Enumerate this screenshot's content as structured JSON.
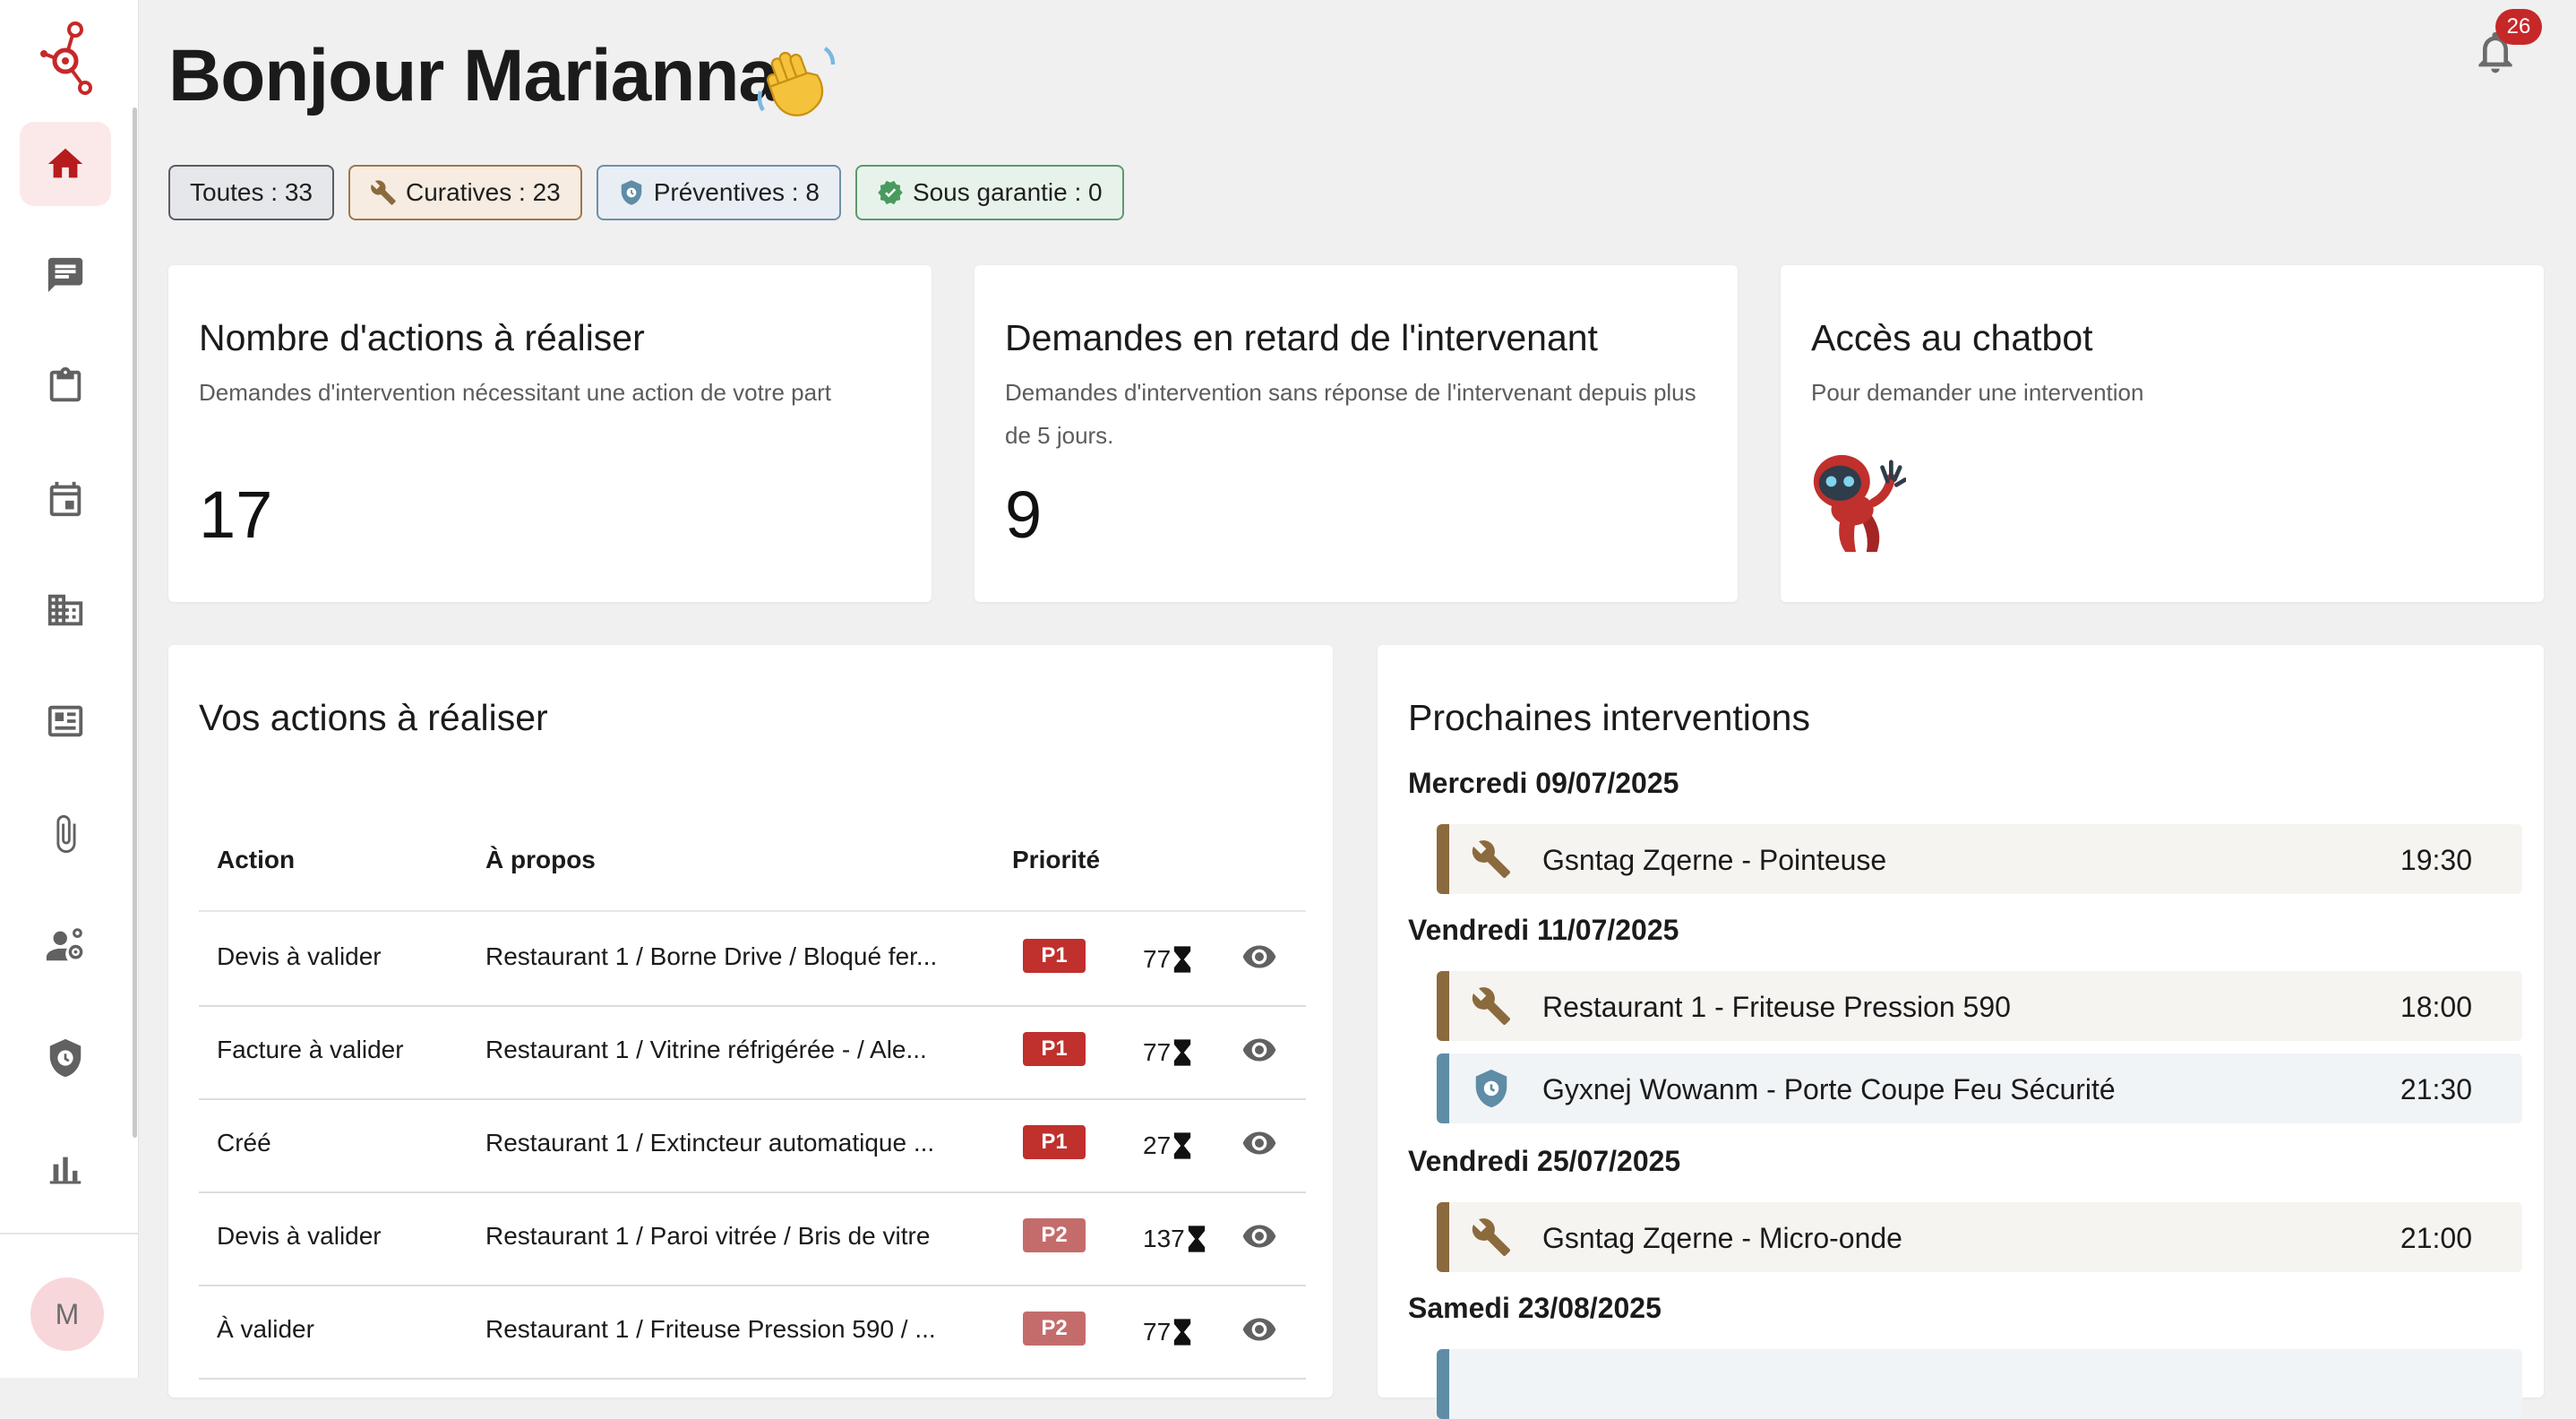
{
  "header": {
    "greeting": "Bonjour Marianna",
    "notifications_count": "26"
  },
  "sidebar": {
    "items": [
      {
        "icon": "home-icon",
        "active": true
      },
      {
        "icon": "chat-icon"
      },
      {
        "icon": "clipboard-icon"
      },
      {
        "icon": "calendar-icon"
      },
      {
        "icon": "building-icon"
      },
      {
        "icon": "id-card-icon"
      },
      {
        "icon": "paperclip-icon"
      },
      {
        "icon": "user-settings-icon"
      },
      {
        "icon": "shield-clock-icon"
      },
      {
        "icon": "bar-chart-icon"
      }
    ],
    "avatar_initial": "M"
  },
  "filters": [
    {
      "label": "Toutes : 33",
      "icon": null
    },
    {
      "label": "Curatives : 23",
      "icon": "wrench-icon"
    },
    {
      "label": "Préventives : 8",
      "icon": "shield-icon"
    },
    {
      "label": "Sous garantie : 0",
      "icon": "verified-badge-icon"
    }
  ],
  "cards": {
    "actions": {
      "title": "Nombre d'actions à réaliser",
      "subtitle": "Demandes d'intervention nécessitant une action de votre part",
      "value": "17"
    },
    "late": {
      "title": "Demandes en retard de l'intervenant",
      "subtitle": "Demandes d'intervention sans réponse de l'intervenant depuis plus de 5 jours.",
      "value": "9"
    },
    "chatbot": {
      "title": "Accès au chatbot",
      "subtitle": "Pour demander une intervention"
    }
  },
  "actions_table": {
    "title": "Vos actions à réaliser",
    "columns": [
      "Action",
      "À propos",
      "Priorité"
    ],
    "rows": [
      {
        "action": "Devis à valider",
        "about": "Restaurant 1 / Borne Drive / Bloqué fer...",
        "priority": "P1",
        "days": "77"
      },
      {
        "action": "Facture à valider",
        "about": "Restaurant 1 / Vitrine réfrigérée - / Ale...",
        "priority": "P1",
        "days": "77"
      },
      {
        "action": "Créé",
        "about": "Restaurant 1 / Extincteur automatique ...",
        "priority": "P1",
        "days": "27"
      },
      {
        "action": "Devis à valider",
        "about": "Restaurant 1 / Paroi vitrée / Bris de vitre",
        "priority": "P2",
        "days": "137"
      },
      {
        "action": "À valider",
        "about": "Restaurant 1 / Friteuse Pression 590 / ...",
        "priority": "P2",
        "days": "77"
      }
    ]
  },
  "upcoming": {
    "title": "Prochaines interventions",
    "days": [
      {
        "label": "Mercredi 09/07/2025",
        "events": [
          {
            "title": "Gsntag Zqerne - Pointeuse",
            "time": "19:30",
            "kind": "curative"
          }
        ]
      },
      {
        "label": "Vendredi 11/07/2025",
        "events": [
          {
            "title": "Restaurant 1 - Friteuse Pression 590",
            "time": "18:00",
            "kind": "curative"
          },
          {
            "title": "Gyxnej Wowanm - Porte Coupe Feu Sécurité",
            "time": "21:30",
            "kind": "preventive"
          }
        ]
      },
      {
        "label": "Vendredi 25/07/2025",
        "events": [
          {
            "title": "Gsntag Zqerne - Micro-onde",
            "time": "21:00",
            "kind": "curative"
          }
        ]
      },
      {
        "label": "Samedi 23/08/2025",
        "events": []
      }
    ]
  },
  "colors": {
    "accent": "#c62828",
    "curative": "#8b6a3e",
    "preventive": "#5f8ca7",
    "p1": "#c0302d",
    "p2": "#c46c6c"
  }
}
